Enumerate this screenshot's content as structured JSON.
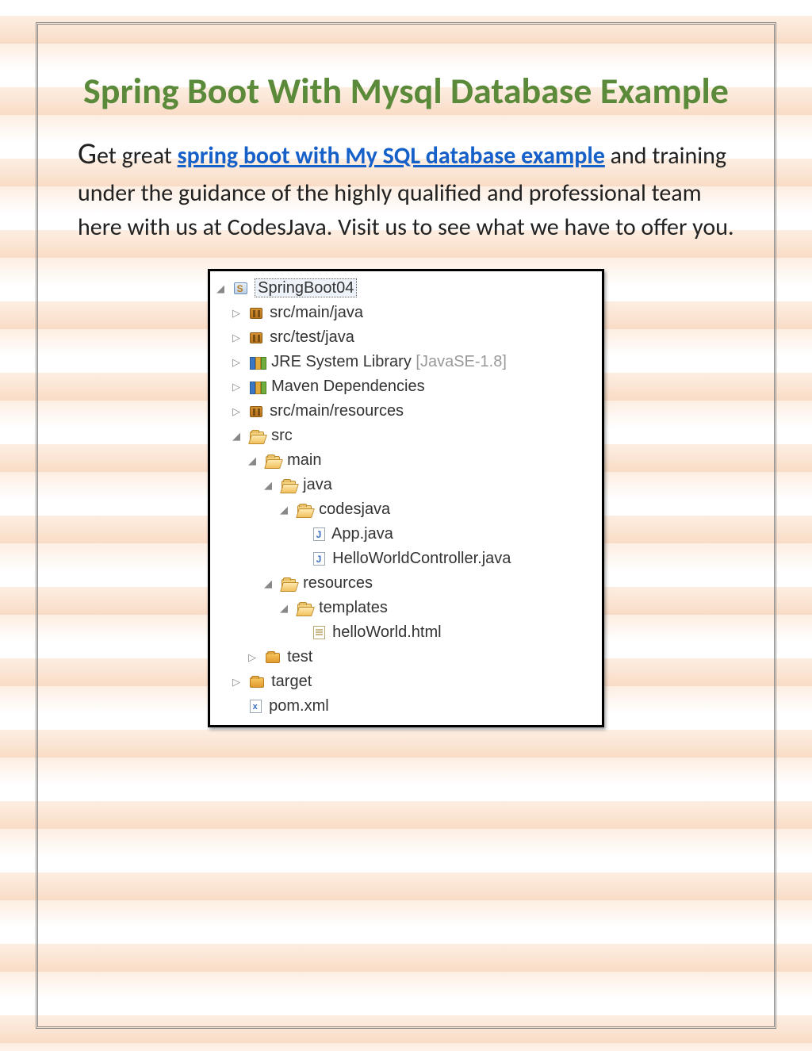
{
  "title": "Spring Boot With Mysql Database Example",
  "paragraph": {
    "lead_char": "G",
    "text_before_link": "et great ",
    "link_text": "spring boot with My SQL database example",
    "text_after_link": " and training under the guidance of the highly qualified and professional team here with us at CodesJava. Visit us to see what we have to offer you."
  },
  "tree": {
    "root": "SpringBoot04",
    "jre_suffix": "[JavaSE-1.8]",
    "items": {
      "src_main_java": "src/main/java",
      "src_test_java": "src/test/java",
      "jre": "JRE System Library ",
      "maven": "Maven Dependencies",
      "src_main_resources": "src/main/resources",
      "src": "src",
      "main": "main",
      "java": "java",
      "codesjava": "codesjava",
      "app_java": "App.java",
      "hello_ctrl": "HelloWorldController.java",
      "resources": "resources",
      "templates": "templates",
      "hello_html": "helloWorld.html",
      "test": "test",
      "target": "target",
      "pom": "pom.xml"
    }
  }
}
